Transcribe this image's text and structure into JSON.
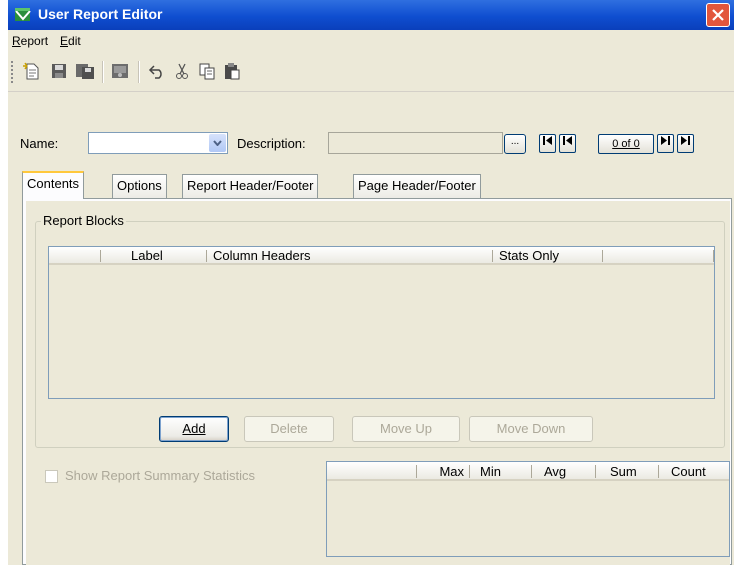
{
  "window": {
    "title": "User Report Editor"
  },
  "menu": [
    {
      "label": "Report"
    },
    {
      "label": "Edit"
    }
  ],
  "toolbar": {
    "icons": [
      "new-report-icon",
      "save-icon",
      "save-as-icon",
      "preview-icon",
      "undo-icon",
      "cut-icon",
      "copy-icon",
      "paste-icon"
    ]
  },
  "form": {
    "name_label": "Name:",
    "name_value": "",
    "description_label": "Description:",
    "description_value": "",
    "ellipsis": "...",
    "record_counter": "0 of 0"
  },
  "tabs": [
    {
      "label": "Contents",
      "active": true
    },
    {
      "label": "Options",
      "active": false
    },
    {
      "label": "Report Header/Footer",
      "active": false
    },
    {
      "label": "Page Header/Footer",
      "active": false
    }
  ],
  "report_blocks": {
    "title": "Report Blocks",
    "columns": [
      "",
      "Label",
      "Column Headers",
      "Stats Only",
      ""
    ],
    "rows": []
  },
  "buttons": {
    "add": "Add",
    "delete": "Delete",
    "move_up": "Move Up",
    "move_down": "Move Down"
  },
  "summary": {
    "checkbox_label": "Show Report Summary Statistics",
    "checked": false,
    "columns": [
      "",
      "Max",
      "Min",
      "Avg",
      "Sum",
      "Count"
    ]
  },
  "colors": {
    "titlebar": "#0f4ed0",
    "close": "#e2563c",
    "panel": "#ece9d8",
    "accent_tab": "#ffc83c"
  }
}
